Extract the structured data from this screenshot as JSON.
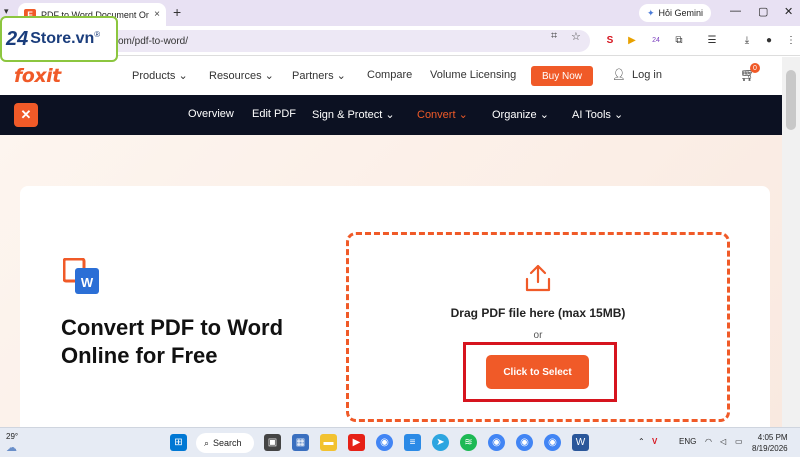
{
  "browser": {
    "tab_title": "PDF to Word Document Online",
    "tab_close": "×",
    "new_tab": "+",
    "url": "om/pdf-to-word/",
    "gemini_label": "Hỏi Gemini",
    "extension_badge": "24"
  },
  "watermark": {
    "number": "24",
    "text": "Store.vn",
    "mark": "®"
  },
  "topnav": {
    "logo": "foxit",
    "items": [
      "Products",
      "Resources",
      "Partners",
      "Compare",
      "Volume Licensing"
    ],
    "buy_now": "Buy Now",
    "login": "Log in",
    "cart_count": "0"
  },
  "subnav": {
    "items": [
      "Overview",
      "Edit PDF",
      "Sign & Protect",
      "Convert",
      "Organize",
      "AI Tools"
    ],
    "active": "Convert"
  },
  "hero": {
    "heading": "Convert PDF to Word Online for Free",
    "drag_text": "Drag PDF file here (max 15MB)",
    "or_text": "or",
    "select_button": "Click to Select"
  },
  "taskbar": {
    "temperature": "29°",
    "search_label": "Search",
    "language": "ENG",
    "time": "4:05 PM",
    "date": "8/19/2026"
  },
  "colors": {
    "accent": "#f05a28",
    "dark_nav": "#0c1122",
    "highlight": "#d6141e"
  }
}
